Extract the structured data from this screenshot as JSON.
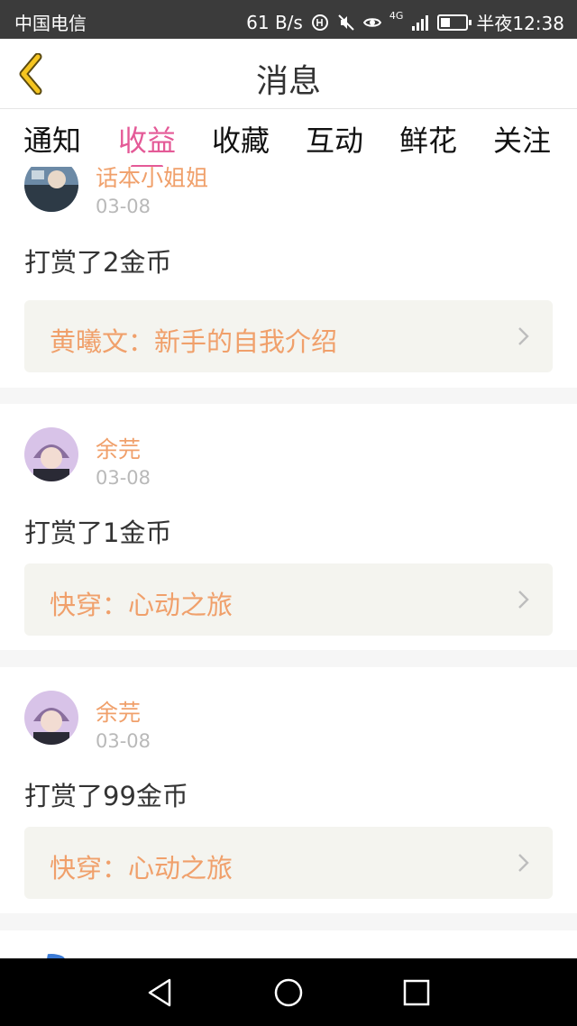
{
  "status_bar": {
    "carrier": "中国电信",
    "speed": "61 B/s",
    "network": "4G",
    "time": "半夜12:38"
  },
  "header": {
    "title": "消息",
    "back_icon": "chevron-left-icon"
  },
  "tabs": [
    "通知",
    "收益",
    "收藏",
    "互动",
    "鲜花",
    "关注"
  ],
  "active_tab": "收益",
  "messages": [
    {
      "username": "话本小姐姐",
      "date": "03-08",
      "reward": "打赏了2金币",
      "link": "黄曦文：新手的自我介绍"
    },
    {
      "username": "余芫",
      "date": "03-08",
      "reward": "打赏了1金币",
      "link": "快穿：心动之旅"
    },
    {
      "username": "余芫",
      "date": "03-08",
      "reward": "打赏了99金币",
      "link": "快穿：心动之旅"
    }
  ],
  "colors": {
    "accent": "#e45a97",
    "link": "#f0a06b",
    "status_bar": "#3b3b3b",
    "back_icon": "#f5c520"
  }
}
